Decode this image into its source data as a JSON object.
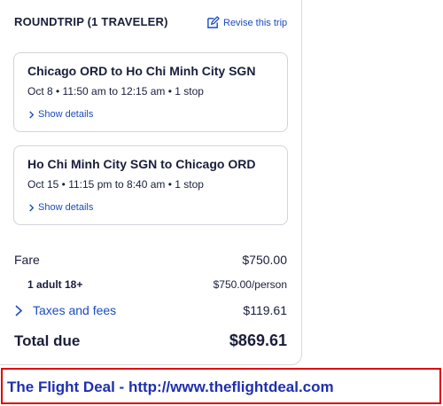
{
  "header": {
    "title": "ROUNDTRIP (1 TRAVELER)",
    "revise_label": "Revise this trip",
    "revise_icon": "edit-pencil-icon"
  },
  "flights": [
    {
      "route": "Chicago ORD to Ho Chi Minh City SGN",
      "schedule": "Oct 8 • 11:50 am to 12:15 am • 1 stop",
      "details_label": "Show details"
    },
    {
      "route": "Ho Chi Minh City SGN to Chicago ORD",
      "schedule": "Oct 15 • 11:15 pm to 8:40 am • 1 stop",
      "details_label": "Show details"
    }
  ],
  "price": {
    "fare_label": "Fare",
    "fare_value": "$750.00",
    "adult_label": "1 adult 18+",
    "adult_value": "$750.00/person",
    "taxes_label": "Taxes and fees",
    "taxes_value": "$119.61",
    "total_label": "Total due",
    "total_value": "$869.61"
  },
  "banner": {
    "text": "The Flight Deal - http://www.theflightdeal.com"
  },
  "colors": {
    "link": "#1a4bbf",
    "text": "#191e3b",
    "banner_border": "#e00000",
    "banner_text": "#1f2fb0"
  }
}
